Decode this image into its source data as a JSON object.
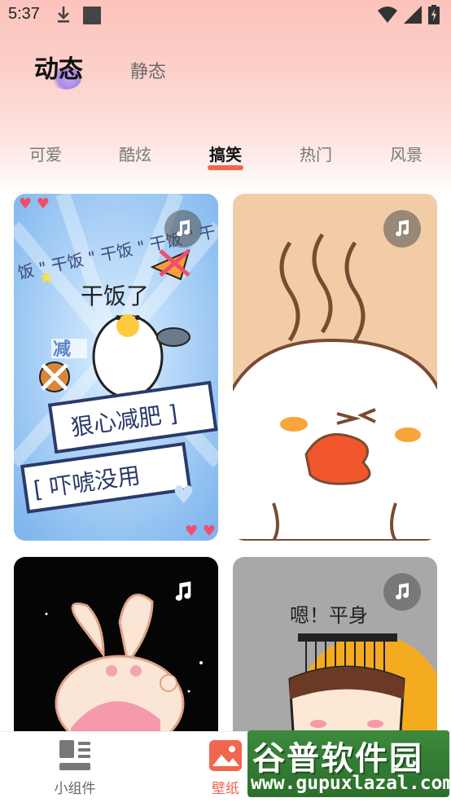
{
  "status_bar": {
    "time": "5:37",
    "icons": [
      "download-icon",
      "square-icon",
      "wifi-icon",
      "signal-icon",
      "battery-icon"
    ]
  },
  "mode_tabs": {
    "active": "动态",
    "inactive": "静态"
  },
  "category_tabs": [
    "可爱",
    "酷炫",
    "搞笑",
    "热门",
    "风景"
  ],
  "category_selected": "搞笑",
  "cards": [
    {
      "id": "duck-diet",
      "has_music": true,
      "texts": [
        "干饭了",
        "狠心减肥",
        "吓唬没用"
      ]
    },
    {
      "id": "duck-blush",
      "has_music": true,
      "texts": []
    },
    {
      "id": "bunny-girl",
      "has_music": true,
      "texts": []
    },
    {
      "id": "emperor",
      "has_music": true,
      "texts": [
        "嗯！平身"
      ]
    }
  ],
  "bottom_nav": {
    "items": [
      {
        "label": "小组件",
        "icon": "widgets-icon",
        "active": false
      },
      {
        "label": "壁纸",
        "icon": "wallpaper-icon",
        "active": true
      }
    ]
  },
  "watermark": {
    "line1": "谷普软件园",
    "line2": "www.gupuxlazal.com"
  },
  "colors": {
    "accent": "#f2654f",
    "header_top": "#fcc3bb"
  }
}
